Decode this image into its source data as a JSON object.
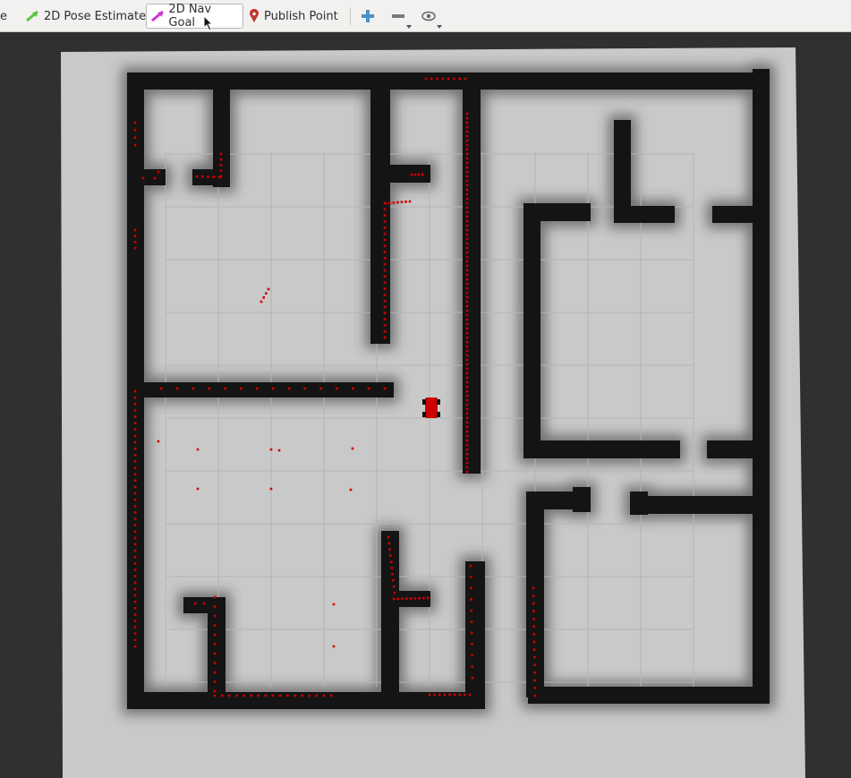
{
  "toolbar": {
    "partial_label": "e",
    "pose_estimate_label": "2D Pose Estimate",
    "nav_goal_label": "2D Nav Goal",
    "publish_point_label": "Publish Point",
    "zoom_in_icon": "plus-icon",
    "zoom_out_icon": "minus-icon",
    "view_icon": "eye-icon"
  },
  "colors": {
    "background": "#303030",
    "map_free": "#d4d4d4",
    "wall": "#141414",
    "grid": "#b4b4b4",
    "laser_points": "#d00000",
    "robot": "#cc0000"
  }
}
